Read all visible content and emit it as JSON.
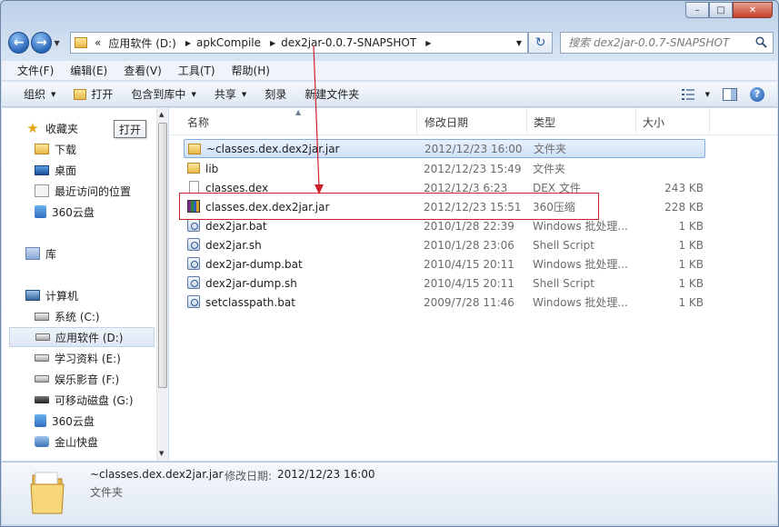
{
  "window": {
    "caption_buttons": {
      "minimize": "–",
      "maximize": "□",
      "close": "✕"
    }
  },
  "address": {
    "overflow": "«",
    "parts": [
      "应用软件 (D:)",
      "apkCompile",
      "dex2jar-0.0.7-SNAPSHOT"
    ]
  },
  "search": {
    "placeholder": "搜索 dex2jar-0.0.7-SNAPSHOT"
  },
  "menu": [
    "文件(F)",
    "编辑(E)",
    "查看(V)",
    "工具(T)",
    "帮助(H)"
  ],
  "toolbar": {
    "organize": "组织",
    "open": "打开",
    "include_library": "包含到库中",
    "share": "共享",
    "burn": "刻录",
    "new_folder": "新建文件夹",
    "help": "?"
  },
  "tooltip": "打开",
  "nav": {
    "favorites": "收藏夹",
    "downloads": "下载",
    "desktop": "桌面",
    "recent": "最近访问的位置",
    "cloud1": "360云盘",
    "libraries": "库",
    "computer": "计算机",
    "drive_c": "系统 (C:)",
    "drive_d": "应用软件 (D:)",
    "drive_e": "学习资料 (E:)",
    "drive_f": "娱乐影音 (F:)",
    "drive_g": "可移动磁盘 (G:)",
    "cloud2": "360云盘",
    "kuaipan": "金山快盘"
  },
  "columns": {
    "name": "名称",
    "date": "修改日期",
    "type": "类型",
    "size": "大小"
  },
  "files": [
    {
      "name": "~classes.dex.dex2jar.jar",
      "date": "2012/12/23 16:00",
      "type": "文件夹",
      "size": "",
      "icon": "folder-icon"
    },
    {
      "name": "lib",
      "date": "2012/12/23 15:49",
      "type": "文件夹",
      "size": "",
      "icon": "folder-icon"
    },
    {
      "name": "classes.dex",
      "date": "2012/12/3 6:23",
      "type": "DEX 文件",
      "size": "243 KB",
      "icon": "document-icon"
    },
    {
      "name": "classes.dex.dex2jar.jar",
      "date": "2012/12/23 15:51",
      "type": "360压缩",
      "size": "228 KB",
      "icon": "archive-icon"
    },
    {
      "name": "dex2jar.bat",
      "date": "2010/1/28 22:39",
      "type": "Windows 批处理...",
      "size": "1 KB",
      "icon": "script-icon"
    },
    {
      "name": "dex2jar.sh",
      "date": "2010/1/28 23:06",
      "type": "Shell Script",
      "size": "1 KB",
      "icon": "script-icon"
    },
    {
      "name": "dex2jar-dump.bat",
      "date": "2010/4/15 20:11",
      "type": "Windows 批处理...",
      "size": "1 KB",
      "icon": "script-icon"
    },
    {
      "name": "dex2jar-dump.sh",
      "date": "2010/4/15 20:11",
      "type": "Shell Script",
      "size": "1 KB",
      "icon": "script-icon"
    },
    {
      "name": "setclasspath.bat",
      "date": "2009/7/28 11:46",
      "type": "Windows 批处理...",
      "size": "1 KB",
      "icon": "script-icon"
    }
  ],
  "details": {
    "name": "~classes.dex.dex2jar.jar",
    "date_label": "修改日期:",
    "date_value": "2012/12/23 16:00",
    "type": "文件夹"
  },
  "colors": {
    "annotation": "#d0202a",
    "selection": "#cfe1f7"
  }
}
